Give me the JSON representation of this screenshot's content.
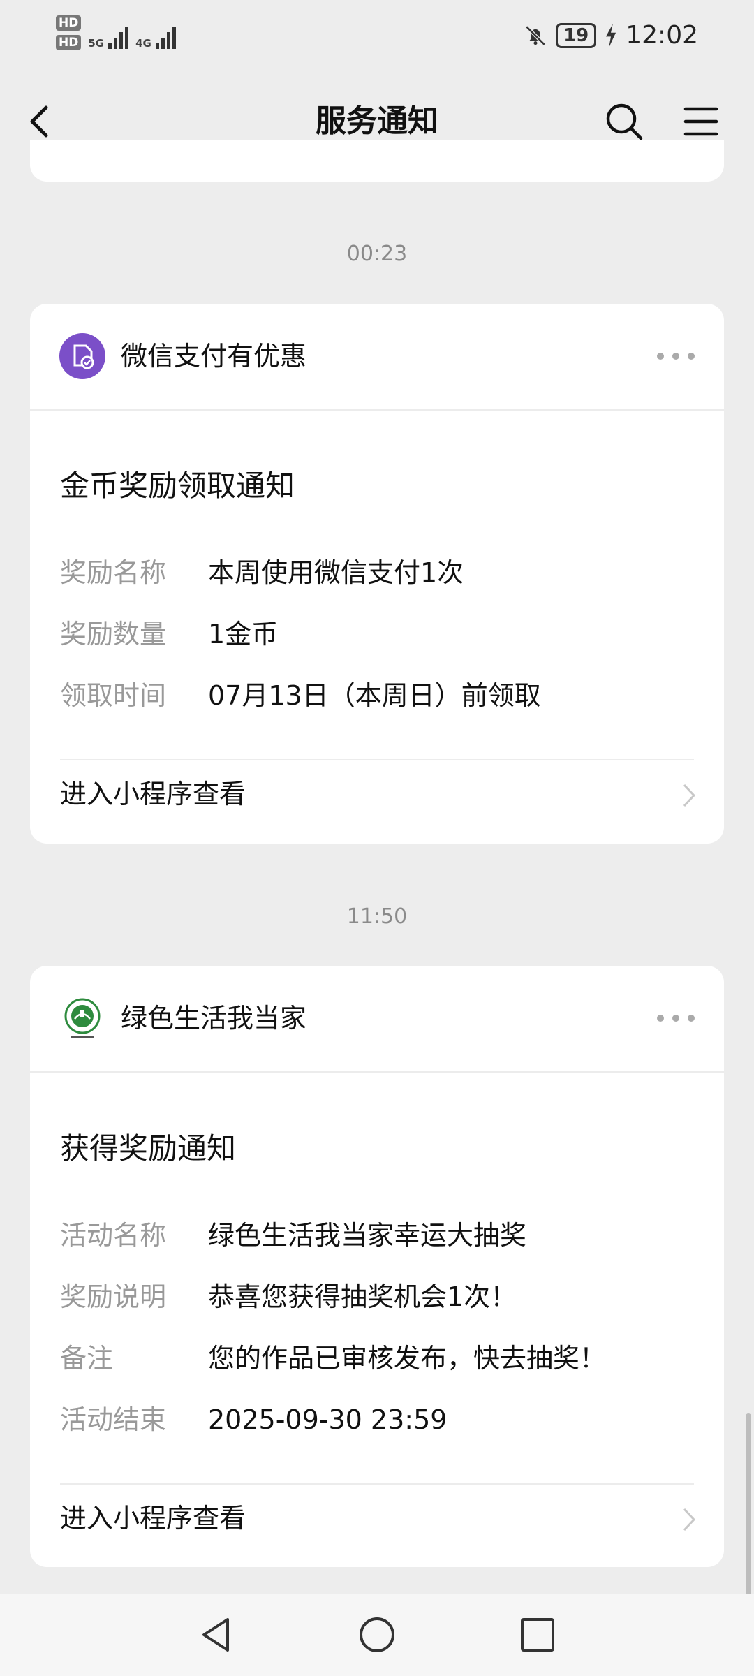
{
  "status_bar": {
    "hd1": "HD",
    "hd2": "HD",
    "net1": "5G",
    "net2": "4G",
    "battery": "19",
    "time": "12:02"
  },
  "nav": {
    "title": "服务通知"
  },
  "messages": [
    {
      "time": "00:23",
      "app_name": "微信支付有优惠",
      "icon": "wechat-pay-coupon-icon",
      "title": "金币奖励领取通知",
      "rows": [
        {
          "key": "奖励名称",
          "value": "本周使用微信支付1次"
        },
        {
          "key": "奖励数量",
          "value": "1金币"
        },
        {
          "key": "领取时间",
          "value": "07月13日（本周日）前领取"
        }
      ],
      "link": "进入小程序查看"
    },
    {
      "time": "11:50",
      "app_name": "绿色生活我当家",
      "icon": "green-life-logo-icon",
      "title": "获得奖励通知",
      "rows": [
        {
          "key": "活动名称",
          "value": "绿色生活我当家幸运大抽奖"
        },
        {
          "key": "奖励说明",
          "value": "恭喜您获得抽奖机会1次！"
        },
        {
          "key": "备注",
          "value": "您的作品已审核发布，快去抽奖！"
        },
        {
          "key": "活动结束",
          "value": "2025-09-30 23:59"
        }
      ],
      "link": "进入小程序查看"
    }
  ],
  "colors": {
    "background": "#ededed",
    "card": "#ffffff",
    "label_gray": "#999999",
    "pay_icon_purple": "#7b4fc8",
    "green_logo": "#2e8b3e"
  }
}
